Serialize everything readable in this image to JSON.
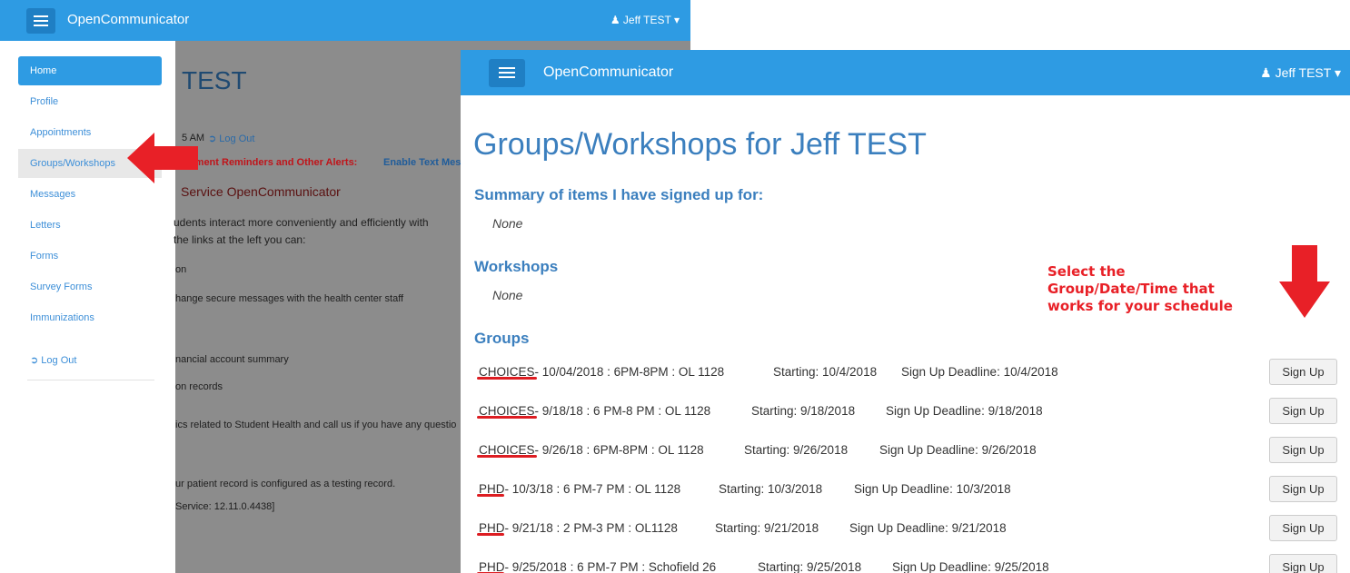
{
  "back": {
    "brand": "OpenCommunicator",
    "user": "Jeff TEST",
    "title": "TEST",
    "sidebar": [
      {
        "label": "Home"
      },
      {
        "label": "Profile"
      },
      {
        "label": "Appointments"
      },
      {
        "label": "Groups/Workshops"
      },
      {
        "label": "Messages"
      },
      {
        "label": "Letters"
      },
      {
        "label": "Forms"
      },
      {
        "label": "Survey Forms"
      },
      {
        "label": "Immunizations"
      },
      {
        "label": "Log Out"
      }
    ],
    "lines": [
      "5 AM",
      "Log Out",
      "tment Reminders and Other Alerts:",
      "Enable Text Mess",
      "Service OpenCommunicator",
      "udents interact more conveniently and efficiently with",
      "the links at the left you can:",
      "on",
      "hange secure messages with the health center staff",
      "nancial account summary",
      "on records",
      "ics related to Student Health and call us if you have any questio",
      "ur patient record is configured as a testing record.",
      "Service: 12.11.0.4438]"
    ]
  },
  "front": {
    "brand": "OpenCommunicator",
    "user": "Jeff TEST",
    "title": "Groups/Workshops for Jeff TEST",
    "summary_head": "Summary of items I have signed up for:",
    "summary_none": "None",
    "workshops_head": "Workshops",
    "workshops_none": "None",
    "groups_head": "Groups",
    "signup_label": "Sign Up",
    "groups": [
      {
        "name": "CHOICES",
        "rest": "- 10/04/2018 : 6PM-8PM : OL 1128",
        "starting": "Starting: 10/4/2018",
        "deadline": "Sign Up Deadline: 10/4/2018"
      },
      {
        "name": "CHOICES",
        "rest": "- 9/18/18 : 6 PM-8 PM : OL 1128",
        "starting": "Starting: 9/18/2018",
        "deadline": "Sign Up Deadline: 9/18/2018"
      },
      {
        "name": "CHOICES",
        "rest": "- 9/26/18 : 6PM-8PM : OL 1128",
        "starting": "Starting: 9/26/2018",
        "deadline": "Sign Up Deadline: 9/26/2018"
      },
      {
        "name": "PHD",
        "rest": "- 10/3/18 : 6 PM-7 PM : OL 1128",
        "starting": "Starting: 10/3/2018",
        "deadline": "Sign Up Deadline: 10/3/2018"
      },
      {
        "name": "PHD",
        "rest": "- 9/21/18 : 2 PM-3 PM : OL1128",
        "starting": "Starting: 9/21/2018",
        "deadline": "Sign Up Deadline: 9/21/2018"
      },
      {
        "name": "PHD",
        "rest": "- 9/25/2018 : 6 PM-7 PM : Schofield 26",
        "starting": "Starting: 9/25/2018",
        "deadline": "Sign Up Deadline: 9/25/2018"
      }
    ]
  },
  "annotation": {
    "line1": "Select the",
    "line2": "Group/Date/Time that",
    "line3": "works for your schedule"
  },
  "colors": {
    "nav": "#2e9be3",
    "accent_red": "#e82027",
    "heading_blue": "#3b7fbe"
  }
}
